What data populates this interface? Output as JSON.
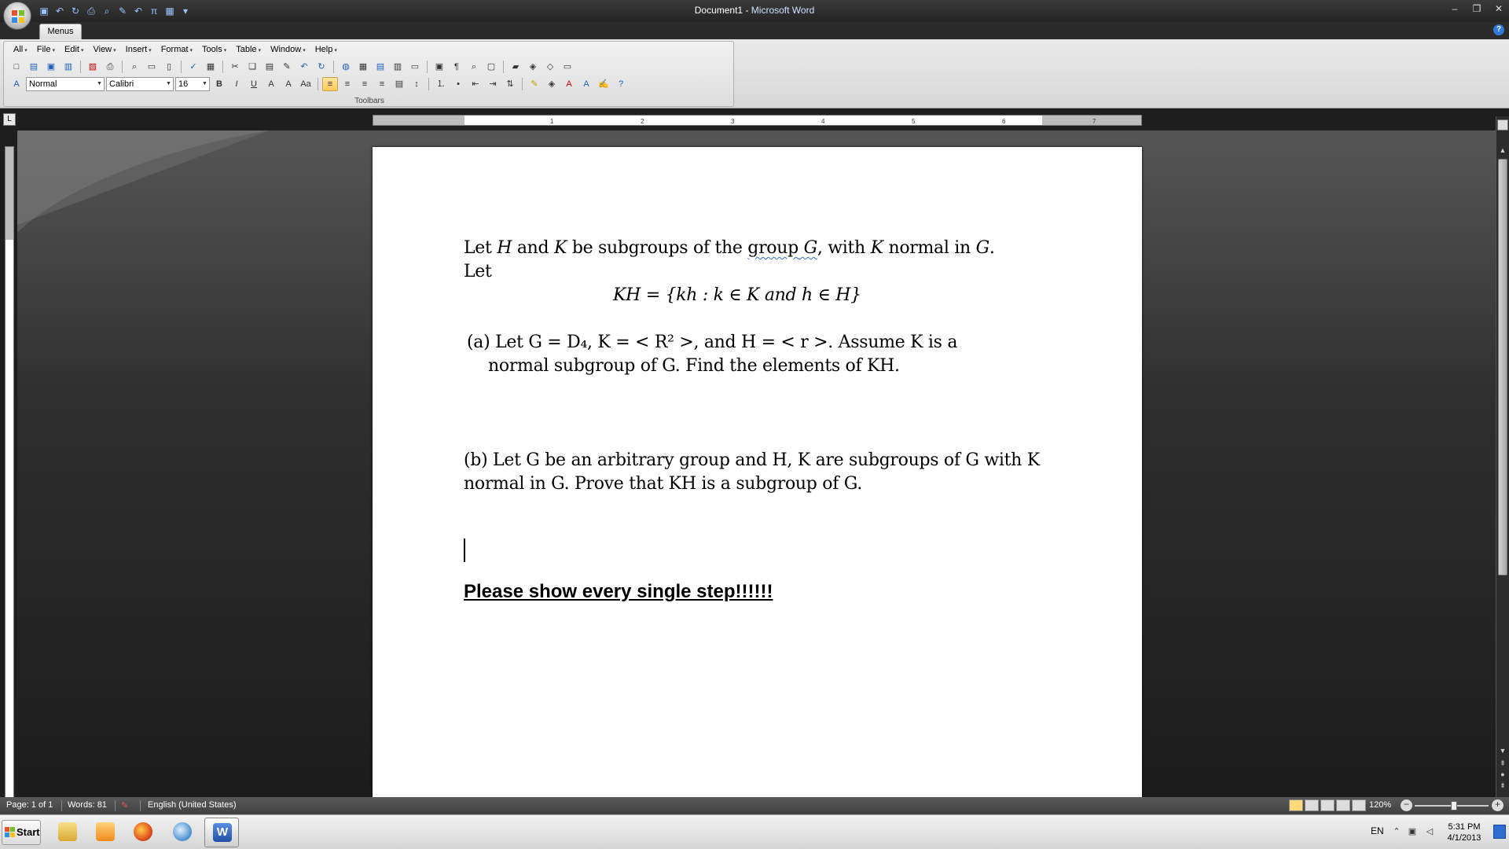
{
  "window": {
    "title_doc": "Document1",
    "title_sep": " - ",
    "title_app": "Microsoft Word"
  },
  "ribbon": {
    "tab": "Menus",
    "menus": [
      "All",
      "File",
      "Edit",
      "View",
      "Insert",
      "Format",
      "Tools",
      "Table",
      "Window",
      "Help"
    ],
    "style_value": "Normal",
    "font_value": "Calibri",
    "size_value": "16",
    "group_label": "Toolbars"
  },
  "document": {
    "intro_line1_a": "Let ",
    "intro_H": "H",
    "intro_line1_b": " and ",
    "intro_K": "K",
    "intro_line1_c": " be subgroups of the ",
    "intro_group_word": "group",
    "intro_G": " G",
    "intro_line1_d": ", with ",
    "intro_K2": "K",
    "intro_line1_e": " normal in ",
    "intro_G2": "G",
    "intro_line1_f": ".",
    "intro_line2": "Let",
    "definition": "KH  = {kh :  k  ∈  K and h  ∈  H}",
    "part_a_line1": "(a)    Let G  =  D₄, K  = < R² >, and H  = < r >. Assume K is a",
    "part_a_line2": "normal subgroup of G. Find the elements of KH.",
    "part_b_line1": "(b) Let G be an arbitrary group and H, K are subgroups of G with K",
    "part_b_line2": "normal in G. Prove that KH is a subgroup of G.",
    "emphasis": "Please show every single step!!!!!!"
  },
  "statusbar": {
    "page": "Page: 1 of 1",
    "words": "Words: 81",
    "language": "English (United States)",
    "zoom": "120%"
  },
  "taskbar": {
    "start": "Start",
    "lang": "EN",
    "time": "5:31 PM",
    "date": "4/1/2013"
  },
  "ruler": {
    "ticks": [
      "1",
      "2",
      "3",
      "4",
      "5",
      "6",
      "7"
    ]
  }
}
